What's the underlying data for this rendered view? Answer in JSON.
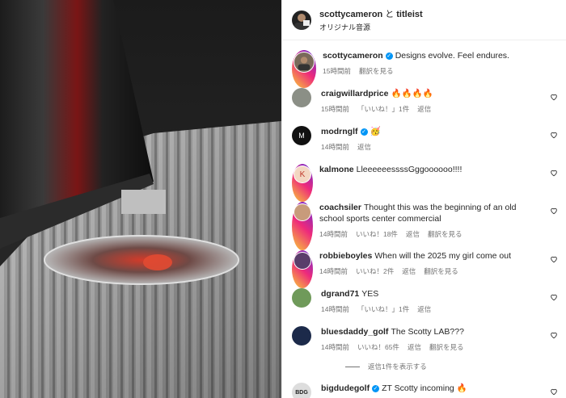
{
  "header": {
    "author": "scottycameron",
    "connector": "と",
    "collaborator": "titleist",
    "audio": "オリジナル音源"
  },
  "caption": {
    "username": "scottycameron",
    "text": "Designs evolve. Feel endures.",
    "time": "15時間前",
    "translate": "翻訳を見る"
  },
  "comments": [
    {
      "username": "craigwillardprice",
      "text": "🔥🔥🔥🔥",
      "verified": false,
      "time": "15時間前",
      "likes": "「いいね！」1件",
      "reply": "返信",
      "translate": ""
    },
    {
      "username": "modrnglf",
      "text": "🥳",
      "verified": true,
      "time": "14時間前",
      "likes": "",
      "reply": "返信",
      "translate": ""
    },
    {
      "username": "kalmone",
      "text": "LleeeeeessssGggoooooo!!!!",
      "verified": false,
      "time": "",
      "likes": "",
      "reply": "",
      "translate": ""
    },
    {
      "username": "coachsiler",
      "text": "Thought this was the beginning of an old school sports center commercial",
      "verified": false,
      "time": "14時間前",
      "likes": "いいね！18件",
      "reply": "返信",
      "translate": "翻訳を見る"
    },
    {
      "username": "robbieboyles",
      "text": "When will the 2025 my girl come out",
      "verified": false,
      "time": "14時間前",
      "likes": "いいね！2件",
      "reply": "返信",
      "translate": "翻訳を見る"
    },
    {
      "username": "dgrand71",
      "text": "YES",
      "verified": false,
      "time": "14時間前",
      "likes": "「いいね！」1件",
      "reply": "返信",
      "translate": ""
    },
    {
      "username": "bluesdaddy_golf",
      "text": "The Scotty LAB???",
      "verified": false,
      "time": "14時間前",
      "likes": "いいね！65件",
      "reply": "返信",
      "translate": "翻訳を見る"
    },
    {
      "username": "bigdudegolf",
      "text": "ZT Scotty incoming 🔥",
      "verified": true,
      "time": "",
      "likes": "",
      "reply": "",
      "translate": ""
    }
  ],
  "view_replies": "返信1件を表示する",
  "colors": {
    "verified": "#0095f6",
    "muted": "#737373",
    "text": "#262626"
  }
}
